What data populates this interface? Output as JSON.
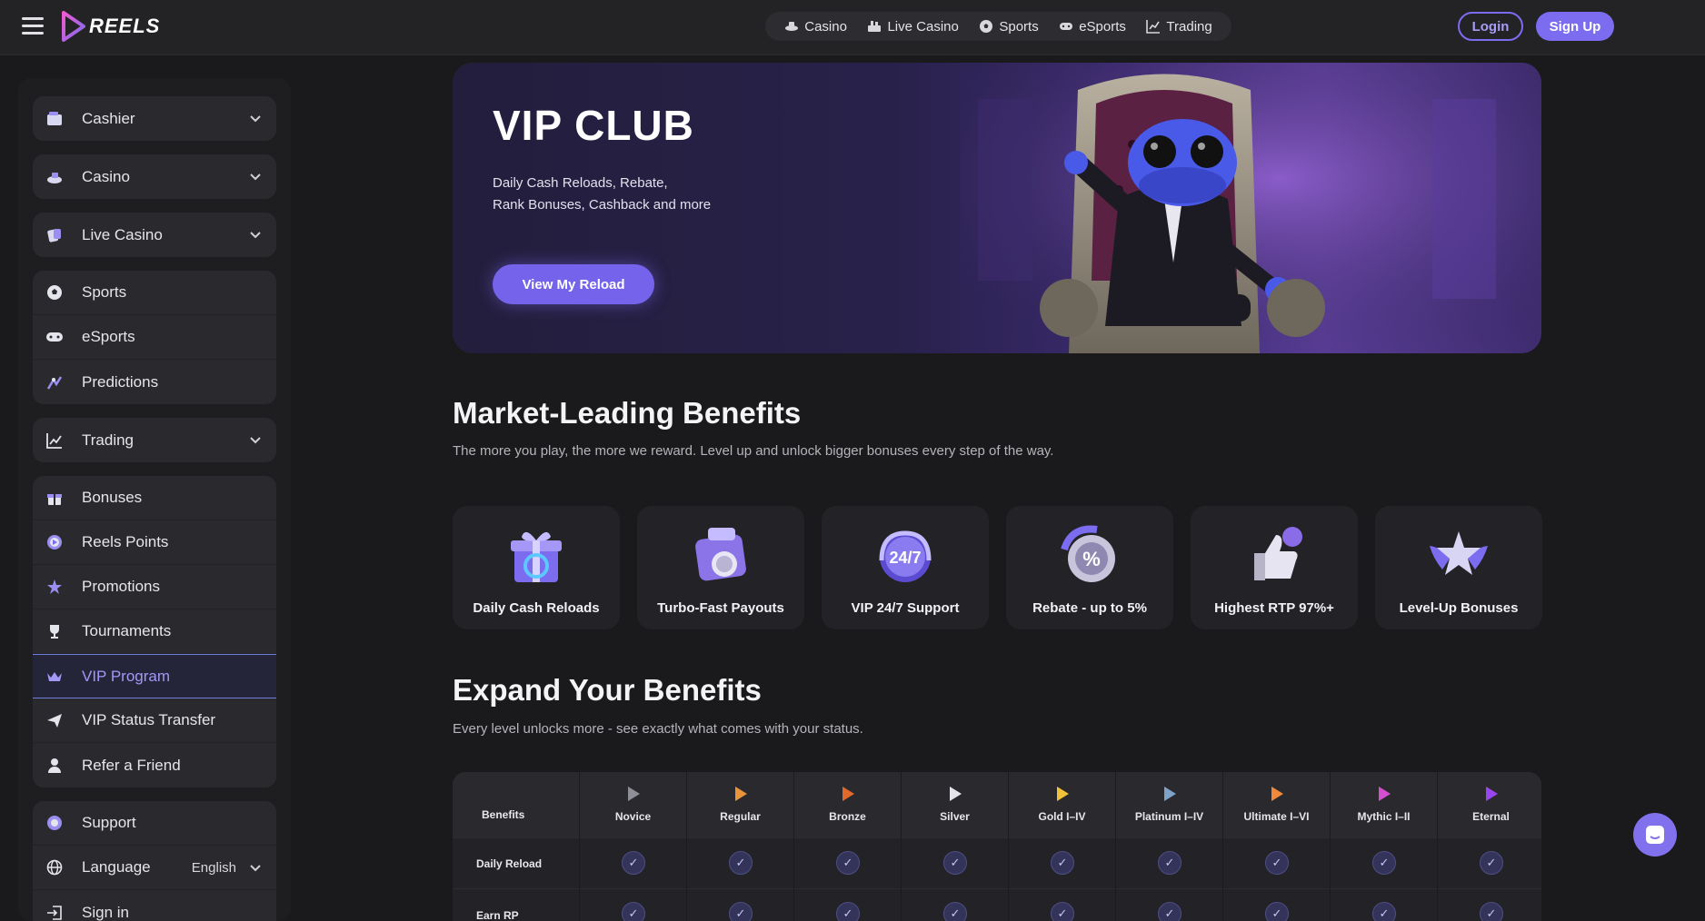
{
  "app": {
    "brand": "REELS",
    "colors": {
      "accent": "#7b6cf0",
      "bg": "#1a1a1c",
      "panel": "#2a2a2e"
    }
  },
  "topnav": {
    "items": [
      {
        "label": "Casino",
        "icon": "casino-icon"
      },
      {
        "label": "Live Casino",
        "icon": "live-casino-icon"
      },
      {
        "label": "Sports",
        "icon": "soccer-ball-icon"
      },
      {
        "label": "eSports",
        "icon": "gamepad-icon"
      },
      {
        "label": "Trading",
        "icon": "chart-icon"
      }
    ],
    "login_label": "Login",
    "signup_label": "Sign Up"
  },
  "sidebar": {
    "group1": [
      {
        "label": "Cashier",
        "icon": "wallet-icon"
      }
    ],
    "group2": [
      {
        "label": "Casino",
        "icon": "casino-icon"
      }
    ],
    "group3": [
      {
        "label": "Live Casino",
        "icon": "live-casino-icon"
      }
    ],
    "group4": [
      {
        "label": "Sports",
        "icon": "soccer-ball-icon"
      },
      {
        "label": "eSports",
        "icon": "gamepad-icon"
      },
      {
        "label": "Predictions",
        "icon": "predictions-icon"
      }
    ],
    "group5": [
      {
        "label": "Trading",
        "icon": "chart-icon"
      }
    ],
    "group6": [
      {
        "label": "Bonuses",
        "icon": "gift-icon"
      },
      {
        "label": "Reels Points",
        "icon": "points-icon"
      },
      {
        "label": "Promotions",
        "icon": "promotions-icon"
      },
      {
        "label": "Tournaments",
        "icon": "trophy-icon"
      },
      {
        "label": "VIP Program",
        "icon": "crown-icon",
        "active": true
      },
      {
        "label": "VIP Status Transfer",
        "icon": "plane-icon"
      },
      {
        "label": "Refer a Friend",
        "icon": "user-icon"
      }
    ],
    "group7": [
      {
        "label": "Support",
        "icon": "support-icon"
      },
      {
        "label": "Language",
        "icon": "globe-icon",
        "value": "English"
      },
      {
        "label": "Sign in",
        "icon": "sign-in-icon"
      }
    ]
  },
  "hero": {
    "title": "VIP CLUB",
    "subtitle_line1": "Daily Cash Reloads, Rebate,",
    "subtitle_line2": "Rank Bonuses, Cashback and more",
    "button_label": "View My Reload"
  },
  "benefits": {
    "title": "Market-Leading Benefits",
    "subtitle": "The more you play, the more we reward. Level up and unlock bigger bonuses every step of the way.",
    "cards": [
      {
        "label": "Daily Cash Reloads",
        "icon": "gift-box-icon"
      },
      {
        "label": "Turbo-Fast Payouts",
        "icon": "wallet-coin-icon"
      },
      {
        "label": "VIP 24/7 Support",
        "icon": "support-24-7-icon"
      },
      {
        "label": "Rebate - up to 5%",
        "icon": "percent-icon"
      },
      {
        "label": "Highest RTP 97%+",
        "icon": "thumbs-up-icon"
      },
      {
        "label": "Level-Up Bonuses",
        "icon": "star-icon"
      }
    ]
  },
  "expand": {
    "title": "Expand Your Benefits",
    "subtitle": "Every level unlocks more - see exactly what comes with your status.",
    "table": {
      "header_label": "Benefits",
      "levels": [
        {
          "label": "Novice",
          "color": "#8f8f98"
        },
        {
          "label": "Regular",
          "color": "#e8943a"
        },
        {
          "label": "Bronze",
          "color": "#e06a2c"
        },
        {
          "label": "Silver",
          "color": "#e4e4ea"
        },
        {
          "label": "Gold I–IV",
          "color": "#f2c23a"
        },
        {
          "label": "Platinum I–IV",
          "color": "#7fa2c8"
        },
        {
          "label": "Ultimate I–VI",
          "color": "#f08a3a"
        },
        {
          "label": "Mythic I–II",
          "color": "#d24fd0"
        },
        {
          "label": "Eternal",
          "color": "#9a46f0"
        }
      ],
      "rows": [
        {
          "label": "Daily Reload",
          "checks": [
            true,
            true,
            true,
            true,
            true,
            true,
            true,
            true,
            true
          ]
        },
        {
          "label": "Earn RP",
          "checks": [
            true,
            true,
            true,
            true,
            true,
            true,
            true,
            true,
            true
          ]
        }
      ],
      "check_glyph": "✓"
    }
  }
}
